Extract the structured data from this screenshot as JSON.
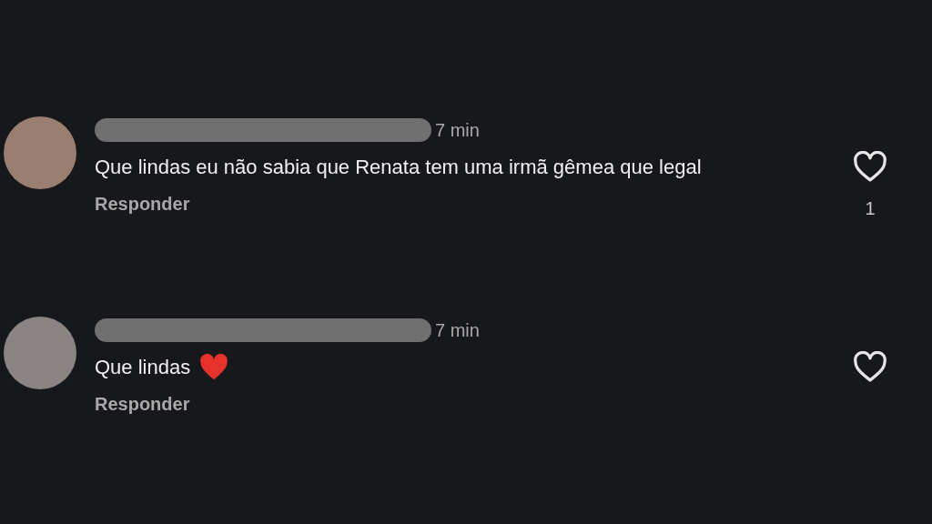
{
  "comments": [
    {
      "time": "7 min",
      "text": "Que lindas eu não sabia que Renata tem uma irmã gêmea que legal",
      "heart_emoji": false,
      "reply_label": "Responder",
      "liked": false,
      "like_count": "1"
    },
    {
      "time": "7 min",
      "text": "Que lindas",
      "heart_emoji": true,
      "reply_label": "Responder",
      "liked": false
    }
  ]
}
